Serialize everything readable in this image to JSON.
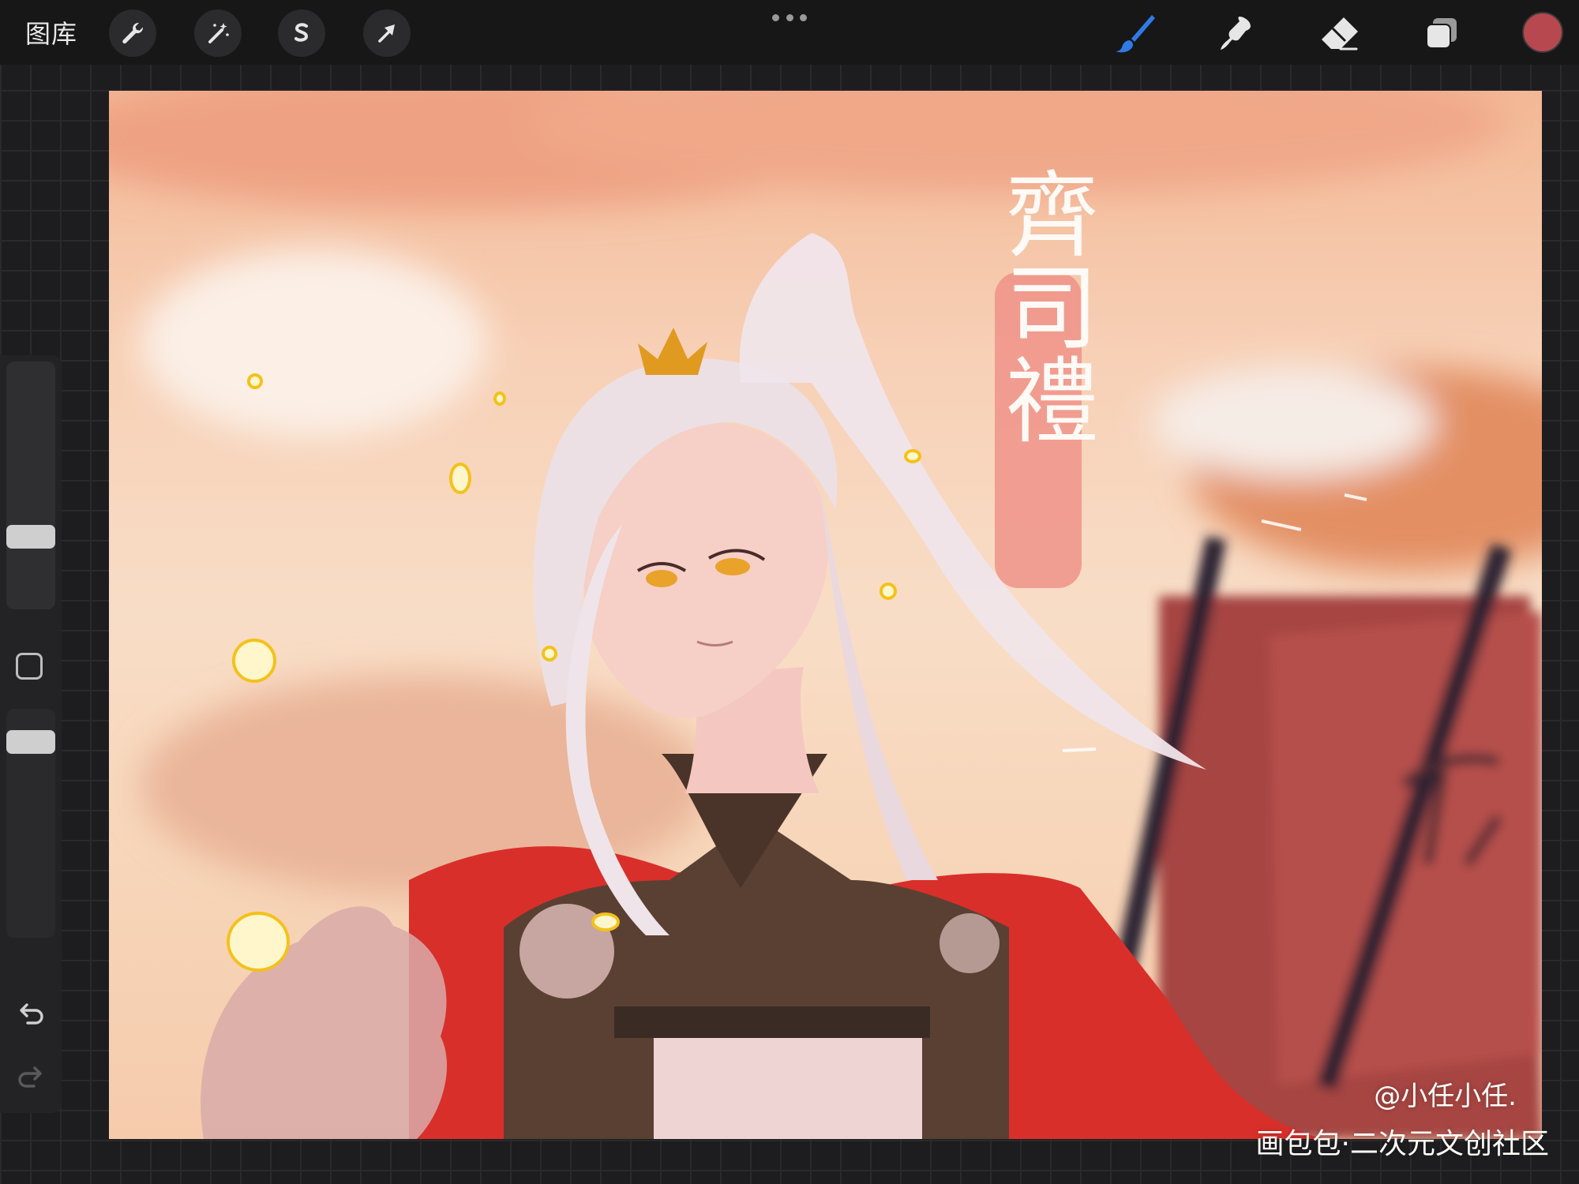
{
  "toolbar": {
    "gallery_label": "图库",
    "left_tools": [
      "wrench-icon",
      "magic-wand-icon",
      "selection-icon",
      "transform-arrow-icon"
    ],
    "more_menu": "more-options-icon",
    "right_tools": [
      "brush-icon",
      "smudge-icon",
      "eraser-icon",
      "layers-icon"
    ],
    "active_tool": "brush-icon",
    "accent_color": "#2f7be6",
    "current_color": "#b8484f"
  },
  "sidebar": {
    "brush_size_level": 0.3,
    "opacity_level": 0.85,
    "buttons": [
      "modify-square-icon",
      "undo-icon",
      "redo-icon"
    ]
  },
  "canvas": {
    "calligraphy_text": "齊司禮",
    "watermark_author": "@小任小任.",
    "watermark_site": "画包包·二次元文创社区"
  }
}
